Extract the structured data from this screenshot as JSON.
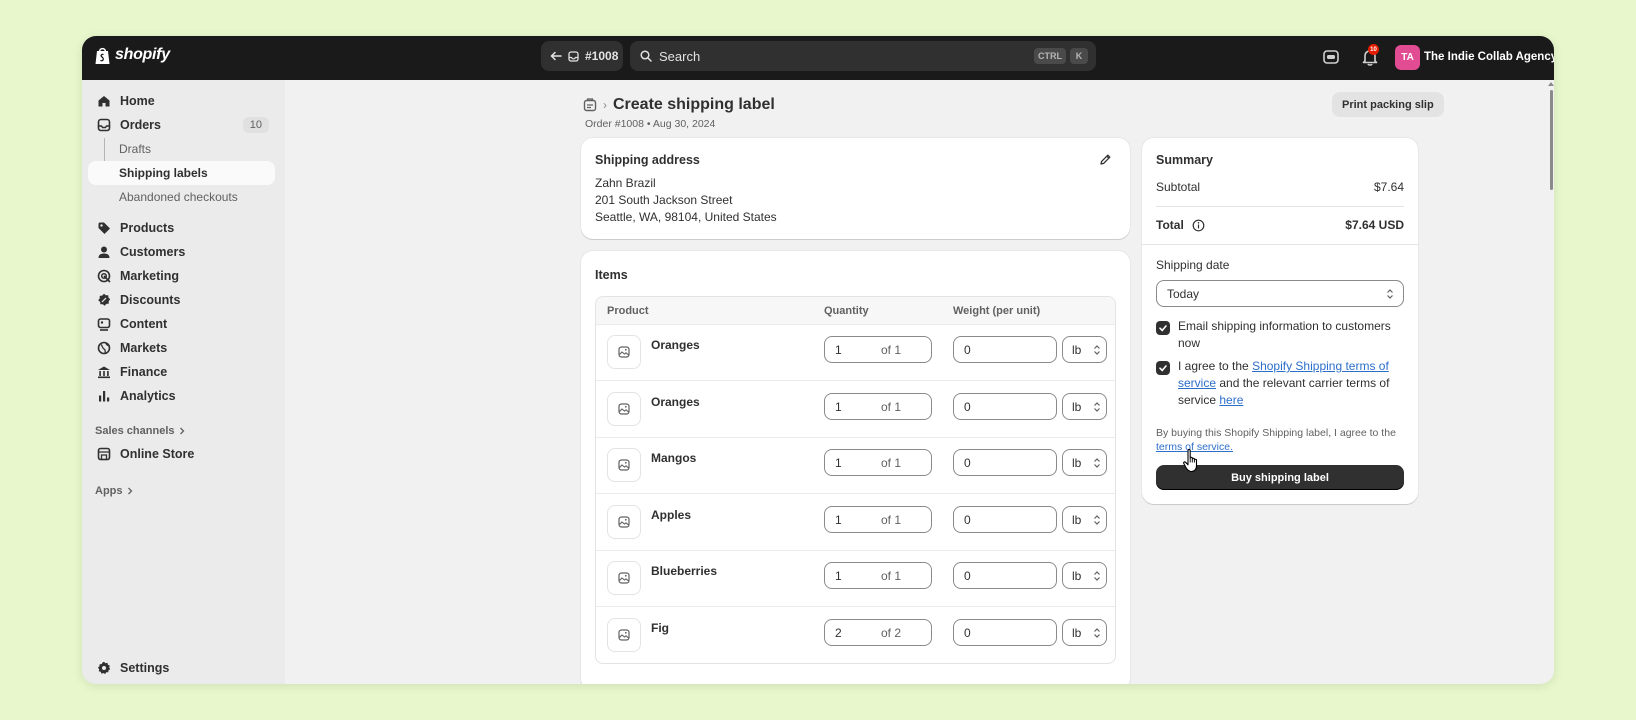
{
  "topbar": {
    "logo_text": "shopify",
    "order_ref": "#1008",
    "search_placeholder": "Search",
    "shortcut_keys": [
      "CTRL",
      "K"
    ],
    "notification_count": "10",
    "avatar_initials": "TA",
    "store_name": "The Indie Collab Agency"
  },
  "sidebar": {
    "home": "Home",
    "orders": "Orders",
    "orders_count": "10",
    "drafts": "Drafts",
    "shipping_labels": "Shipping labels",
    "abandoned_checkouts": "Abandoned checkouts",
    "products": "Products",
    "customers": "Customers",
    "marketing": "Marketing",
    "discounts": "Discounts",
    "content": "Content",
    "markets": "Markets",
    "finance": "Finance",
    "analytics": "Analytics",
    "sales_channels": "Sales channels",
    "online_store": "Online Store",
    "apps": "Apps",
    "settings": "Settings"
  },
  "page": {
    "title": "Create shipping label",
    "subtitle": "Order #1008 • Aug 30, 2024",
    "print_button": "Print packing slip"
  },
  "address": {
    "title": "Shipping address",
    "name": "Zahn Brazil",
    "street": "201 South Jackson Street",
    "city": "Seattle, WA, 98104, United States"
  },
  "items": {
    "title": "Items",
    "headers": {
      "product": "Product",
      "quantity": "Quantity",
      "weight": "Weight (per unit)"
    },
    "rows": [
      {
        "name": "Oranges",
        "qty": "1",
        "of": "of 1",
        "weight": "0",
        "unit": "lb"
      },
      {
        "name": "Oranges",
        "qty": "1",
        "of": "of 1",
        "weight": "0",
        "unit": "lb"
      },
      {
        "name": "Mangos",
        "qty": "1",
        "of": "of 1",
        "weight": "0",
        "unit": "lb"
      },
      {
        "name": "Apples",
        "qty": "1",
        "of": "of 1",
        "weight": "0",
        "unit": "lb"
      },
      {
        "name": "Blueberries",
        "qty": "1",
        "of": "of 1",
        "weight": "0",
        "unit": "lb"
      },
      {
        "name": "Fig",
        "qty": "2",
        "of": "of 2",
        "weight": "0",
        "unit": "lb"
      }
    ]
  },
  "summary": {
    "title": "Summary",
    "subtotal_label": "Subtotal",
    "subtotal_value": "$7.64",
    "total_label": "Total",
    "total_value": "$7.64 USD",
    "shipping_date_label": "Shipping date",
    "shipping_date_value": "Today",
    "email_check_label": "Email shipping information to customers now",
    "agree_prefix": "I agree to the ",
    "agree_link": "Shopify Shipping terms of service",
    "agree_middle": " and the relevant carrier terms of service ",
    "agree_here": "here",
    "fine_print": "By buying this Shopify Shipping label, I agree to the ",
    "fine_link": "terms of service.",
    "buy_button": "Buy shipping label"
  },
  "colors": {
    "topbar": "#1a1a1a",
    "background": "#e8f8cc",
    "primary_button": "#303030",
    "link": "#2c6ecb",
    "avatar": "#e14c93",
    "badge": "#e51c00"
  }
}
